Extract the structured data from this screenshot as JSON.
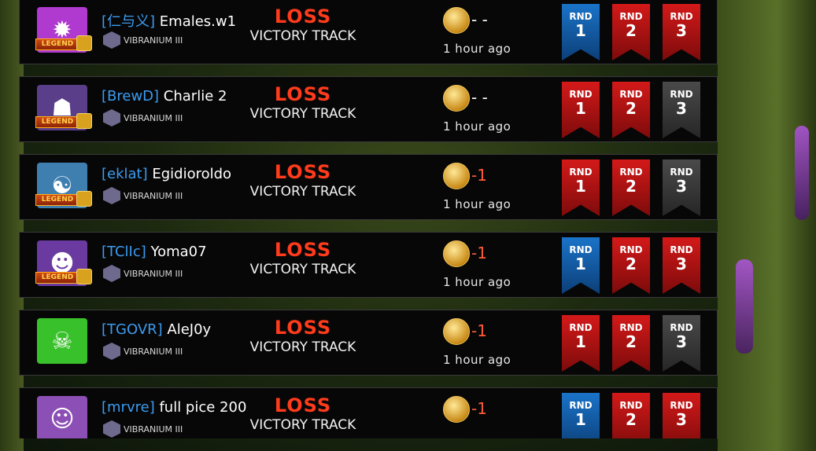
{
  "rows": [
    {
      "tag": "[仁与义]",
      "name": "Emales.w1",
      "legend": "LEGEND",
      "rank": "VIBRANIUM III",
      "result": "LOSS",
      "mode": "VICTORY TRACK",
      "points": "- -",
      "time": "1 hour ago",
      "rounds": [
        "win",
        "lose",
        "lose"
      ],
      "avatar_color": "#b03ad0",
      "avatar_glyph": "✹"
    },
    {
      "tag": "[BrewD]",
      "name": "Charlie 2",
      "legend": "LEGEND",
      "rank": "VIBRANIUM III",
      "result": "LOSS",
      "mode": "VICTORY TRACK",
      "points": "- -",
      "time": "1 hour ago",
      "rounds": [
        "lose",
        "lose",
        "unplayed"
      ],
      "avatar_color": "#5a3e8a",
      "avatar_glyph": "☗"
    },
    {
      "tag": "[eklat]",
      "name": "Egidioroldo",
      "legend": "LEGEND",
      "rank": "VIBRANIUM III",
      "result": "LOSS",
      "mode": "VICTORY TRACK",
      "points": "-1",
      "time": "1 hour ago",
      "rounds": [
        "lose",
        "lose",
        "unplayed"
      ],
      "avatar_color": "#3e7fb0",
      "avatar_glyph": "☯"
    },
    {
      "tag": "[TClIc]",
      "name": "Yoma07",
      "legend": "LEGEND",
      "rank": "VIBRANIUM III",
      "result": "LOSS",
      "mode": "VICTORY TRACK",
      "points": "-1",
      "time": "1 hour ago",
      "rounds": [
        "win",
        "lose",
        "lose"
      ],
      "avatar_color": "#6a3aa0",
      "avatar_glyph": "☻"
    },
    {
      "tag": "[TGOVR]",
      "name": "AleJ0y",
      "legend": "",
      "rank": "VIBRANIUM III",
      "result": "LOSS",
      "mode": "VICTORY TRACK",
      "points": "-1",
      "time": "1 hour ago",
      "rounds": [
        "lose",
        "lose",
        "unplayed"
      ],
      "avatar_color": "#39c12b",
      "avatar_glyph": "☠"
    },
    {
      "tag": "[mrvre]",
      "name": "full pice 200",
      "legend": "",
      "rank": "VIBRANIUM III",
      "result": "LOSS",
      "mode": "VICTORY TRACK",
      "points": "-1",
      "time": "",
      "rounds": [
        "win",
        "lose",
        "lose"
      ],
      "avatar_color": "#8c4fb5",
      "avatar_glyph": "☺"
    }
  ],
  "rnd_label": "RND",
  "rnd_numbers": [
    "1",
    "2",
    "3"
  ]
}
